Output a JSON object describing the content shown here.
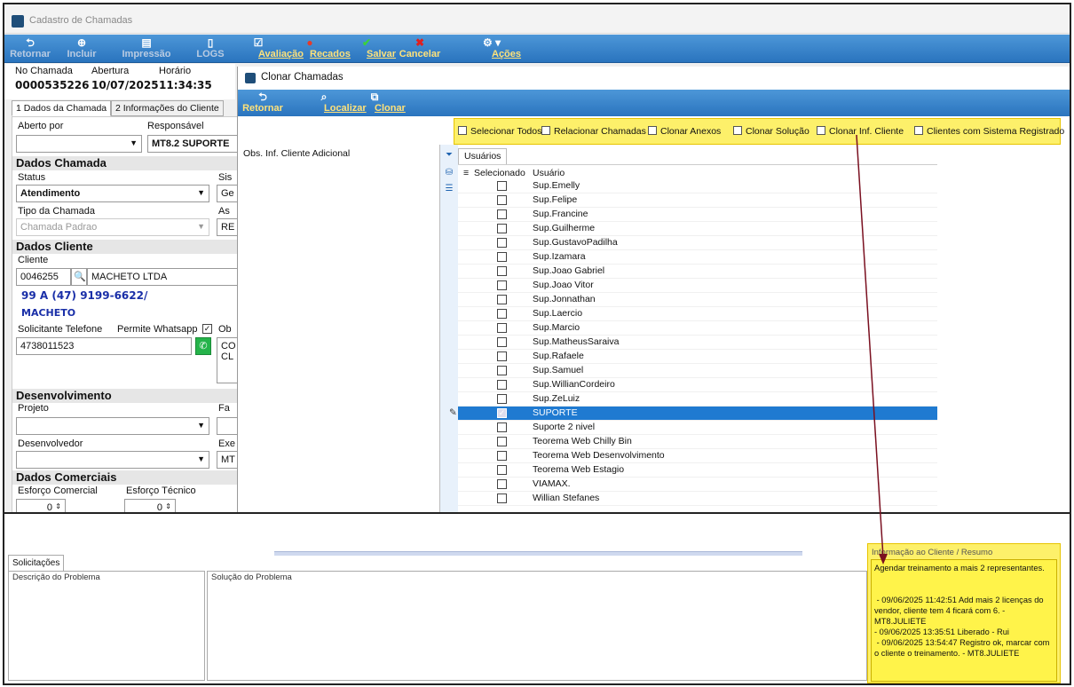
{
  "main_window": {
    "title": "Cadastro de Chamadas",
    "toolbar": [
      {
        "label": "Retornar",
        "icon": "return-icon",
        "enabled": false
      },
      {
        "label": "Incluir",
        "icon": "add-icon",
        "enabled": false
      },
      {
        "label": "Impressão",
        "icon": "print-icon",
        "enabled": false
      },
      {
        "label": "LOGS",
        "icon": "log-icon",
        "enabled": false
      },
      {
        "label": "Avaliação",
        "icon": "check-icon",
        "enabled": true
      },
      {
        "label": "Recados",
        "icon": "message-icon",
        "enabled": true
      },
      {
        "label": "Salvar",
        "icon": "save-icon",
        "enabled": true
      },
      {
        "label": "Cancelar",
        "icon": "cancel-icon",
        "enabled": true
      },
      {
        "label": "Ações",
        "icon": "actions-icon",
        "enabled": true
      }
    ],
    "header": {
      "no_chamada_label": "No Chamada",
      "no_chamada": "0000535226",
      "abertura_label": "Abertura",
      "abertura": "10/07/2025",
      "horario_label": "Horário",
      "horario": "11:34:35"
    },
    "tabs": [
      "1 Dados da Chamada",
      "2 Informações do Cliente"
    ]
  },
  "form": {
    "aberto_por_label": "Aberto por",
    "aberto_por": "",
    "responsavel_label": "Responsável",
    "responsavel": "MT8.2 SUPORTE",
    "section_dados_chamada": "Dados Chamada",
    "status_label": "Status",
    "status": "Atendimento",
    "sis_label": "Sis",
    "sis_value": "Ge",
    "tipo_label": "Tipo da Chamada",
    "tipo": "Chamada Padrao",
    "as_label": "As",
    "as_value": "RE",
    "section_dados_cliente": "Dados Cliente",
    "cliente_label": "Cliente",
    "cliente_code": "0046255",
    "cliente_name": "MACHETO LTDA",
    "phone_line": "99 A (47) 9199-6622/",
    "contact": "MACHETO",
    "solicitante_label": "Solicitante Telefone",
    "whatsapp_label": "Permite Whatsapp",
    "whatsapp_checked": true,
    "telefone": "4738011523",
    "ob_label": "Ob",
    "ob_text": "CO\nCL",
    "section_desenvolvimento": "Desenvolvimento",
    "projeto_label": "Projeto",
    "fa_label": "Fa",
    "desenvolvedor_label": "Desenvolvedor",
    "exe_label": "Exe",
    "exe_value": "MT",
    "section_dados_comerciais": "Dados Comerciais",
    "esforco_comercial_label": "Esforço Comercial",
    "esforco_comercial": "0",
    "esforco_tecnico_label": "Esforço Técnico",
    "esforco_tecnico": "0"
  },
  "clone_window": {
    "title": "Clonar Chamadas",
    "toolbar": [
      {
        "label": "Retornar",
        "icon": "return-icon"
      },
      {
        "label": "Localizar",
        "icon": "search-icon"
      },
      {
        "label": "Clonar",
        "icon": "clone-icon"
      }
    ],
    "options": [
      {
        "label": "Selecionar Todos",
        "checked": false
      },
      {
        "label": "Relacionar Chamadas",
        "checked": false
      },
      {
        "label": "Clonar Anexos",
        "checked": false
      },
      {
        "label": "Clonar Solução",
        "checked": false
      },
      {
        "label": "Clonar Inf. Cliente",
        "checked": false
      },
      {
        "label": "Clientes com Sistema Registrado",
        "checked": false
      }
    ],
    "obs_header": "Obs. Inf. Cliente Adicional",
    "grid_tab": "Usuários",
    "grid_headers": {
      "selecionado": "Selecionado",
      "usuario": "Usuário"
    },
    "users": [
      {
        "name": "Sup.Emelly",
        "checked": false
      },
      {
        "name": "Sup.Felipe",
        "checked": false
      },
      {
        "name": "Sup.Francine",
        "checked": false
      },
      {
        "name": "Sup.Guilherme",
        "checked": false
      },
      {
        "name": "Sup.GustavoPadilha",
        "checked": false
      },
      {
        "name": "Sup.Izamara",
        "checked": false
      },
      {
        "name": "Sup.Joao Gabriel",
        "checked": false
      },
      {
        "name": "Sup.Joao Vitor",
        "checked": false
      },
      {
        "name": "Sup.Jonnathan",
        "checked": false
      },
      {
        "name": "Sup.Laercio",
        "checked": false
      },
      {
        "name": "Sup.Marcio",
        "checked": false
      },
      {
        "name": "Sup.MatheusSaraiva",
        "checked": false
      },
      {
        "name": "Sup.Rafaele",
        "checked": false
      },
      {
        "name": "Sup.Samuel",
        "checked": false
      },
      {
        "name": "Sup.WillianCordeiro",
        "checked": false
      },
      {
        "name": "Sup.ZeLuiz",
        "checked": false
      },
      {
        "name": "SUPORTE",
        "checked": true,
        "selected": true
      },
      {
        "name": "Suporte 2 nivel",
        "checked": false
      },
      {
        "name": "Teorema Web Chilly Bin",
        "checked": false
      },
      {
        "name": "Teorema Web Desenvolvimento",
        "checked": false
      },
      {
        "name": "Teorema Web Estagio",
        "checked": false
      },
      {
        "name": "VIAMAX.",
        "checked": false
      },
      {
        "name": "Willian Stefanes",
        "checked": false
      }
    ]
  },
  "bottom": {
    "tab": "Solicitações",
    "desc_header": "Descrição do Problema",
    "sol_header": "Solução do Problema",
    "info_header": "Informação ao Cliente / Resumo",
    "info_text": "Agendar treinamento a mais 2 representantes.\n\n\n - 09/06/2025 11:42:51 Add mais 2 licenças do vendor, cliente tem 4 ficará com 6. - MT8.JULIETE\n- 09/06/2025 13:35:51 Liberado - Rui\n - 09/06/2025 13:54:47 Registro ok, marcar com o cliente o treinamento. - MT8.JULIETE"
  },
  "colors": {
    "toolbar_blue": "#2a74be",
    "label_yellow": "#ffe27a",
    "highlight_yellow": "#fdf06a",
    "selection_blue": "#1f7ad1",
    "arrow": "#7a1020"
  }
}
